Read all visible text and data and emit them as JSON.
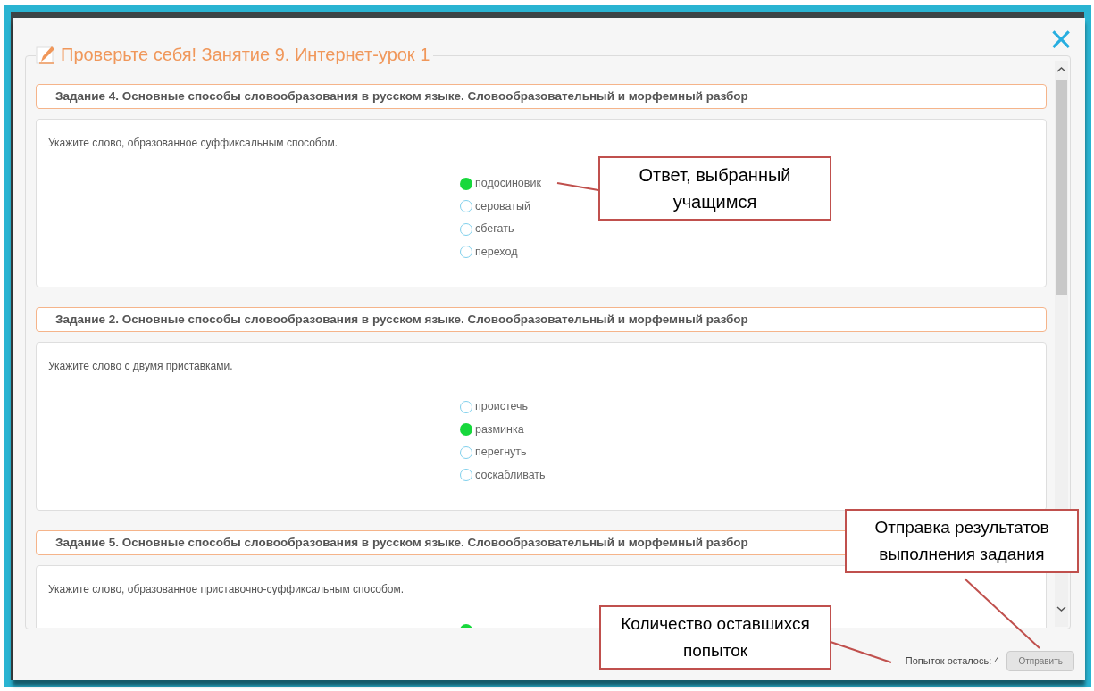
{
  "dialog": {
    "title": "Проверьте себя! Занятие 9. Интернет-урок 1",
    "close": "×"
  },
  "tasks": [
    {
      "heading": "Задание 4. Основные способы словообразования в русском языке. Словообразовательный и морфемный разбор",
      "question": "Укажите слово, образованное суффиксальным способом.",
      "options": [
        {
          "label": "подосиновик",
          "selected": true
        },
        {
          "label": "сероватый",
          "selected": false
        },
        {
          "label": "сбегать",
          "selected": false
        },
        {
          "label": "переход",
          "selected": false
        }
      ]
    },
    {
      "heading": "Задание 2. Основные способы словообразования в русском языке. Словообразовательный и морфемный разбор",
      "question": "Укажите слово с двумя приставками.",
      "options": [
        {
          "label": "проистечь",
          "selected": false
        },
        {
          "label": "разминка",
          "selected": true
        },
        {
          "label": "перегнуть",
          "selected": false
        },
        {
          "label": "соскабливать",
          "selected": false
        }
      ]
    },
    {
      "heading": "Задание 5. Основные способы словообразования в русском языке. Словообразовательный и морфемный разбор",
      "question": "Укажите слово, образованное приставочно-суффиксальным способом.",
      "options": [
        {
          "selected": true
        }
      ]
    }
  ],
  "footer": {
    "attempts": "Попыток осталось: 4",
    "submit": "Отправить"
  },
  "callouts": [
    {
      "text": "Ответ, выбранный учащимся"
    },
    {
      "text": "Отправка результатов выполнения задания"
    },
    {
      "text": "Количество оставшихся попыток"
    }
  ]
}
